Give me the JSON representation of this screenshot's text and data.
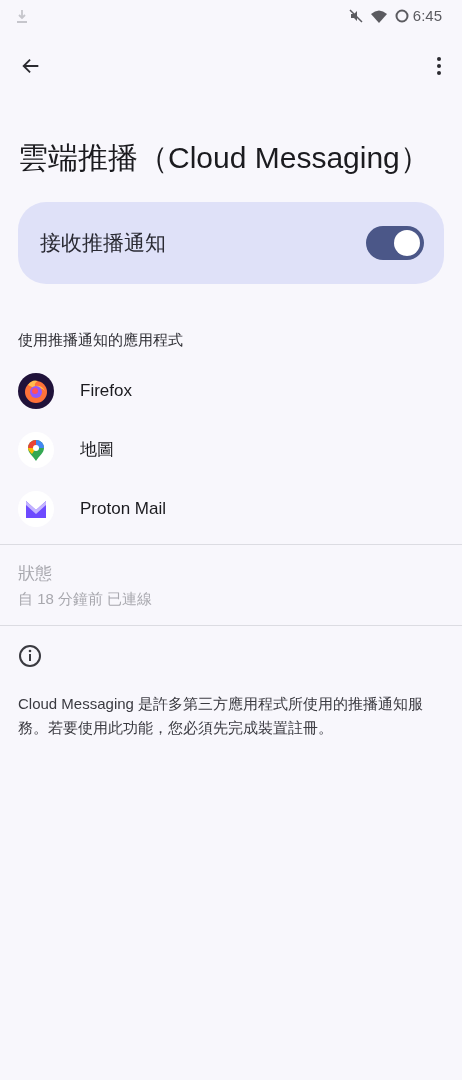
{
  "status_bar": {
    "time": "6:45"
  },
  "title": "雲端推播（Cloud Messaging）",
  "main_switch": {
    "label": "接收推播通知",
    "on": true
  },
  "apps_section": {
    "heading": "使用推播通知的應用程式",
    "apps": [
      {
        "name": "Firefox",
        "kind": "fox"
      },
      {
        "name": "地圖",
        "kind": "pin"
      },
      {
        "name": "Proton Mail",
        "kind": "mail"
      }
    ]
  },
  "status": {
    "label": "狀態",
    "value": "自 18 分鐘前 已連線"
  },
  "info": "Cloud Messaging 是許多第三方應用程式所使用的推播通知服務。若要使用此功能，您必須先完成裝置註冊。"
}
